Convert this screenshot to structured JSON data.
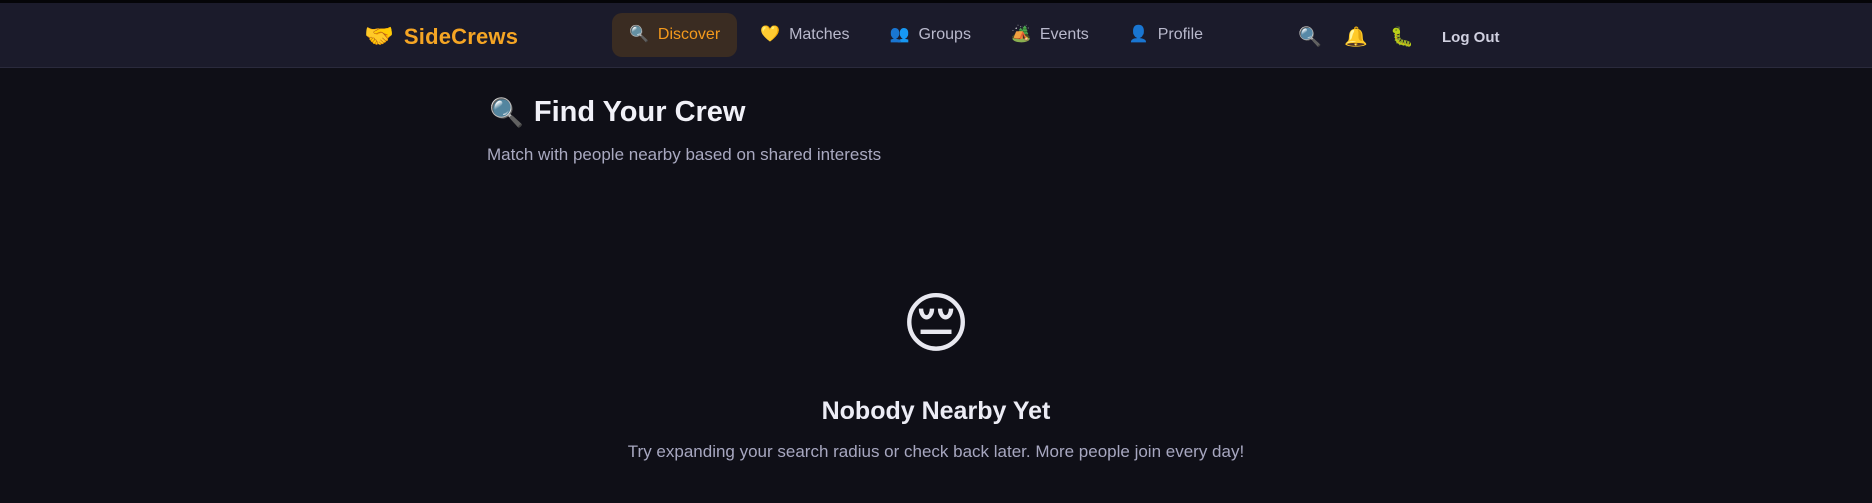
{
  "brand": {
    "icon": "🤝",
    "name": "SideCrews"
  },
  "nav": [
    {
      "icon": "🔍",
      "label": "Discover",
      "active": true
    },
    {
      "icon": "💛",
      "label": "Matches"
    },
    {
      "icon": "👥",
      "label": "Groups"
    },
    {
      "icon": "🏕️",
      "label": "Events"
    },
    {
      "icon": "👤",
      "label": "Profile"
    }
  ],
  "header_actions": {
    "search_icon": "🔍",
    "notifications_icon": "🔔",
    "bug_icon": "🐛",
    "logout_label": "Log Out"
  },
  "page": {
    "title_icon": "🔍",
    "title": "Find Your Crew",
    "subtitle": "Match with people nearby based on shared interests"
  },
  "empty_state": {
    "emoji": "😔",
    "title": "Nobody Nearby Yet",
    "message": "Try expanding your search radius or check back later. More people join every day!"
  },
  "colors": {
    "accent": "#f5a524",
    "background": "#0f0f17",
    "topbar": "#1b1b2b"
  }
}
